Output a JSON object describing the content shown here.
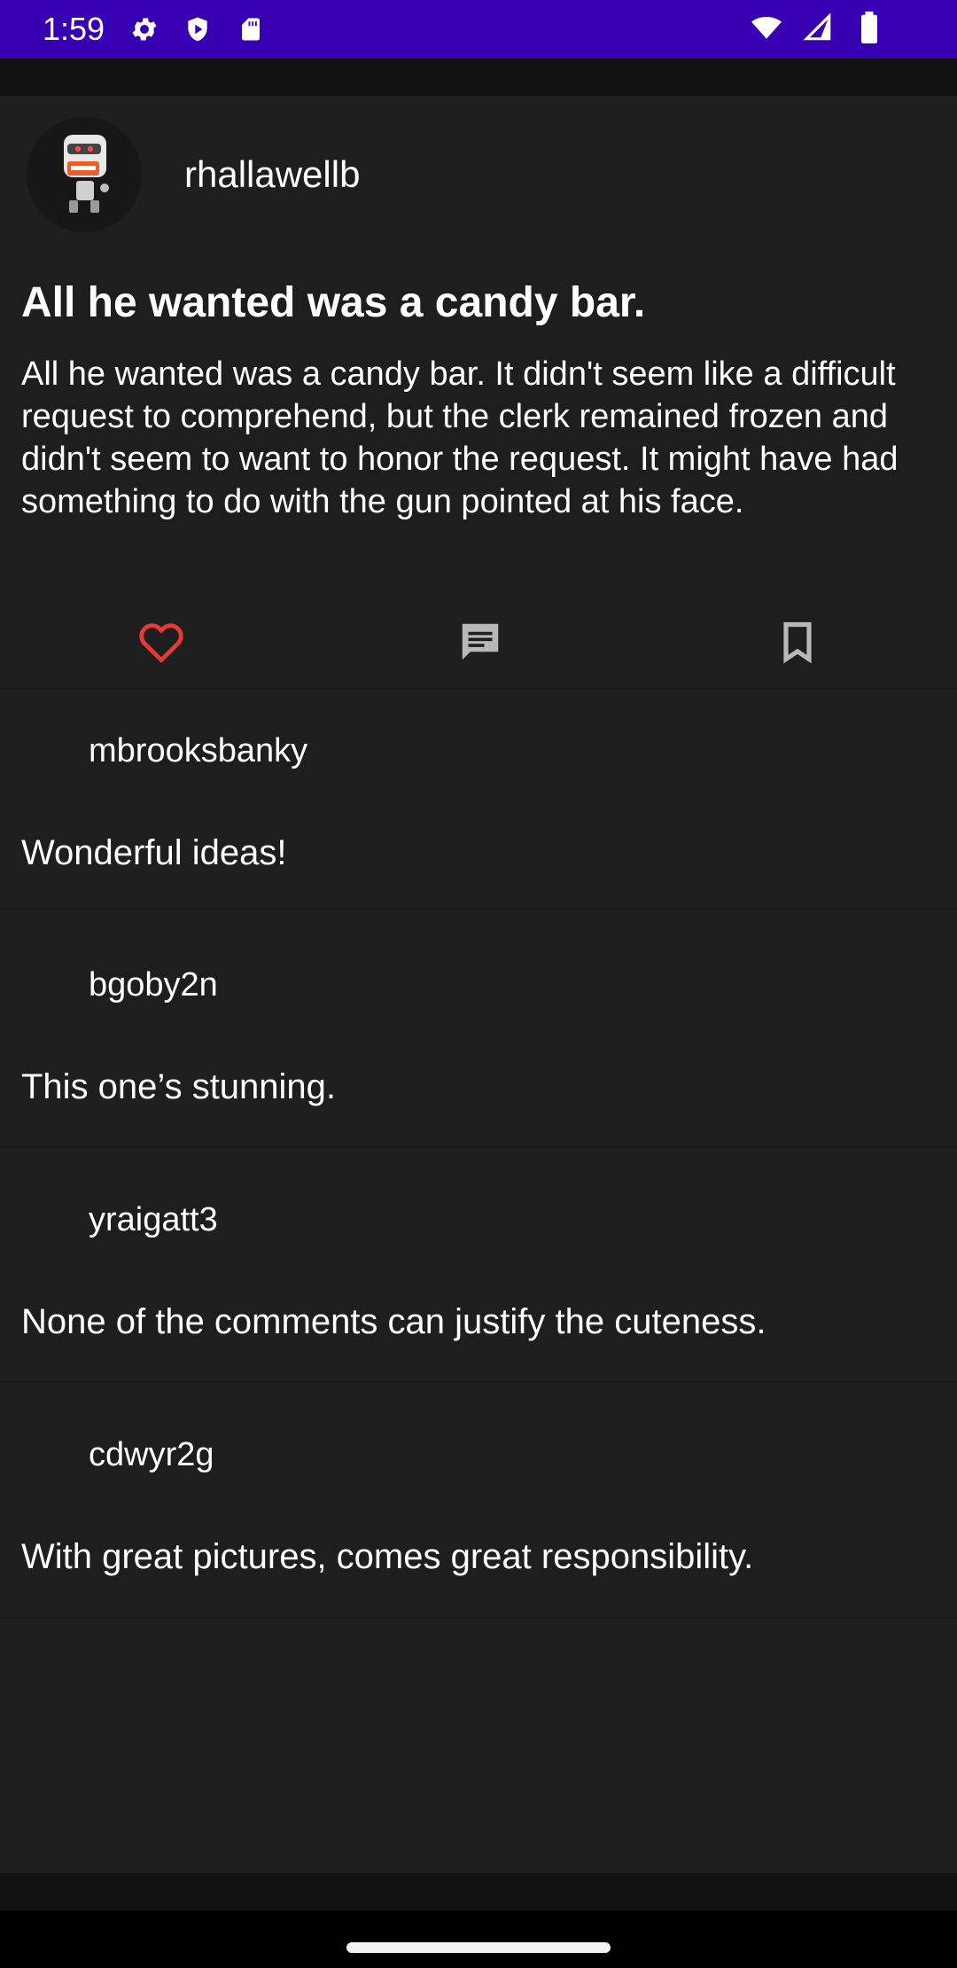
{
  "status_bar": {
    "time": "1:59",
    "left_icons": [
      "gear-icon",
      "shield-play-icon",
      "sd-card-icon"
    ],
    "right_icons": [
      "wifi-icon",
      "signal-icon",
      "battery-icon"
    ],
    "background": "#3700b3"
  },
  "post": {
    "author": "rhallawellb",
    "avatar_icon": "robot-avatar-icon",
    "title": "All he wanted was a candy bar.",
    "body": "All he wanted was a candy bar. It didn't seem like a difficult request to comprehend, but the clerk remained frozen and didn't seem to want to honor the request. It might have had something to do with the gun pointed at his face."
  },
  "actions": {
    "like_icon": "heart-outline-icon",
    "comment_icon": "comment-icon",
    "bookmark_icon": "bookmark-outline-icon",
    "like_color": "#e53935"
  },
  "comments": [
    {
      "author": "mbrooksbanky",
      "text": "Wonderful ideas!"
    },
    {
      "author": "bgoby2n",
      "text": "This one’s stunning."
    },
    {
      "author": "yraigatt3",
      "text": "None of the comments can justify the cuteness."
    },
    {
      "author": "cdwyr2g",
      "text": "With great pictures, comes great responsibility."
    }
  ],
  "colors": {
    "surface": "#1e1e1e",
    "background": "#121212",
    "text": "#ffffff"
  }
}
